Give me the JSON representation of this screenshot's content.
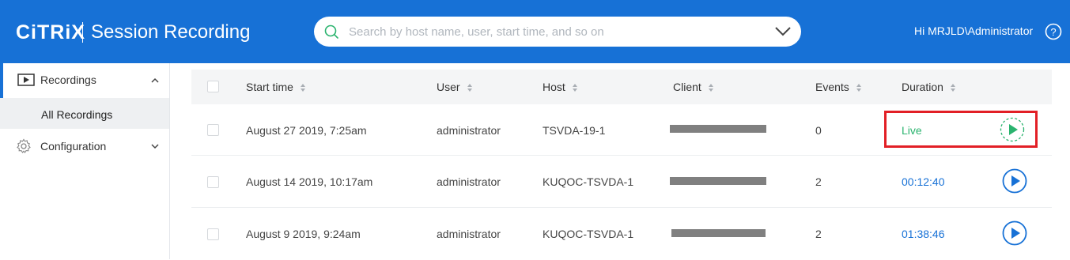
{
  "header": {
    "brand": "CiTRiX",
    "app_title": "Session Recording",
    "search_placeholder": "Search by host name, user, start time, and so on",
    "greeting": "Hi MRJLD\\Administrator"
  },
  "sidebar": {
    "items": [
      {
        "label": "Recordings",
        "expanded": true,
        "icon": "play-square-icon"
      },
      {
        "label": "All Recordings",
        "selected": true
      },
      {
        "label": "Configuration",
        "expanded": false,
        "icon": "gear-icon"
      }
    ]
  },
  "table": {
    "columns": [
      "Start time",
      "User",
      "Host",
      "Client",
      "Events",
      "Duration"
    ],
    "rows": [
      {
        "start_time": "August 27 2019, 7:25am",
        "user": "administrator",
        "host": "TSVDA-19-1",
        "client": "",
        "events": "0",
        "duration": "Live",
        "live": true
      },
      {
        "start_time": "August 14 2019, 10:17am",
        "user": "administrator",
        "host": "KUQOC-TSVDA-1",
        "client": "",
        "events": "2",
        "duration": "00:12:40",
        "live": false
      },
      {
        "start_time": "August 9 2019, 9:24am",
        "user": "administrator",
        "host": "KUQOC-TSVDA-1",
        "client": "",
        "events": "2",
        "duration": "01:38:46",
        "live": false
      }
    ]
  },
  "colors": {
    "header_bg": "#1771d6",
    "live_green": "#2ab36e",
    "link_blue": "#1771d6",
    "highlight_red": "#e21f26",
    "redaction_gray": "#808080"
  }
}
